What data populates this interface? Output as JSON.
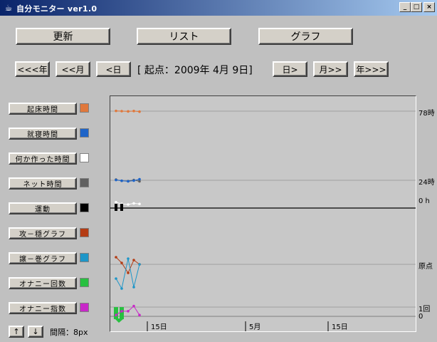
{
  "window": {
    "title": "自分モニター ver1.0",
    "app_icon": "coffee-cup-icon",
    "min_label": "_",
    "max_label": "□",
    "close_label": "×"
  },
  "toolbar": {
    "update_label": "更新",
    "list_label": "リスト",
    "graph_label": "グラフ"
  },
  "nav": {
    "prev_year": "<<<年",
    "prev_month": "<<月",
    "prev_day": "<日",
    "start_label": "[ 起点：2009年 4月 9日]",
    "next_day": "日>",
    "next_month": "月>>",
    "next_year": "年>>>"
  },
  "legend": [
    {
      "label": "起床時間",
      "color": "#e0783c"
    },
    {
      "label": "就寝時間",
      "color": "#1e64c8"
    },
    {
      "label": "何か作った時間",
      "color": "#ffffff"
    },
    {
      "label": "ネット時間",
      "color": "#606060"
    },
    {
      "label": "運動",
      "color": "#000000"
    },
    {
      "label": "攻－穏グラフ",
      "color": "#b43c14"
    },
    {
      "label": "譲－巻グラフ",
      "color": "#1e96c8"
    },
    {
      "label": "オナニー回数",
      "color": "#28c040"
    },
    {
      "label": "オナニー指数",
      "color": "#c828c8"
    }
  ],
  "bottom": {
    "up_label": "↑",
    "down_label": "↓",
    "interval_label": "間隔：8px"
  },
  "chart_data": {
    "type": "line",
    "right_axis_labels": [
      "78時",
      "24時",
      "0 h",
      "原点",
      "1回",
      "0"
    ],
    "x_tick_labels": [
      "15日",
      "5月",
      "15日"
    ],
    "series": [
      {
        "name": "起床時間",
        "color": "#e0783c",
        "values": [
          78.2,
          78.0,
          77.8,
          78.1,
          77.6
        ]
      },
      {
        "name": "就寝時間",
        "color": "#1e64c8",
        "values": [
          24.2,
          23.6,
          23.1,
          23.7,
          24.8
        ]
      },
      {
        "name": "何か作った時間",
        "color": "#ffffff",
        "values": [
          0.4,
          0.1,
          0.0,
          0.2,
          0.1
        ]
      },
      {
        "name": "ネット時間",
        "color": "#606060",
        "values": [
          24.5,
          23.5,
          23.3,
          24.2,
          23.1
        ]
      },
      {
        "name": "運動",
        "color": "#000000",
        "values": [
          1,
          1,
          0,
          0,
          0
        ]
      },
      {
        "name": "攻－穏グラフ",
        "color": "#b43c14",
        "values": [
          0.5,
          0.1,
          -0.6,
          0.3,
          0.0
        ]
      },
      {
        "name": "譲－巻グラフ",
        "color": "#1e96c8",
        "values": [
          -1.0,
          -1.7,
          0.4,
          -1.6,
          0.0
        ]
      },
      {
        "name": "オナニー回数",
        "color": "#28c040",
        "values": [
          1,
          1,
          0,
          0,
          0
        ]
      },
      {
        "name": "オナニー指数",
        "color": "#c828c8",
        "values": [
          0.1,
          0.4,
          0.4,
          0.8,
          0.1
        ]
      }
    ]
  }
}
